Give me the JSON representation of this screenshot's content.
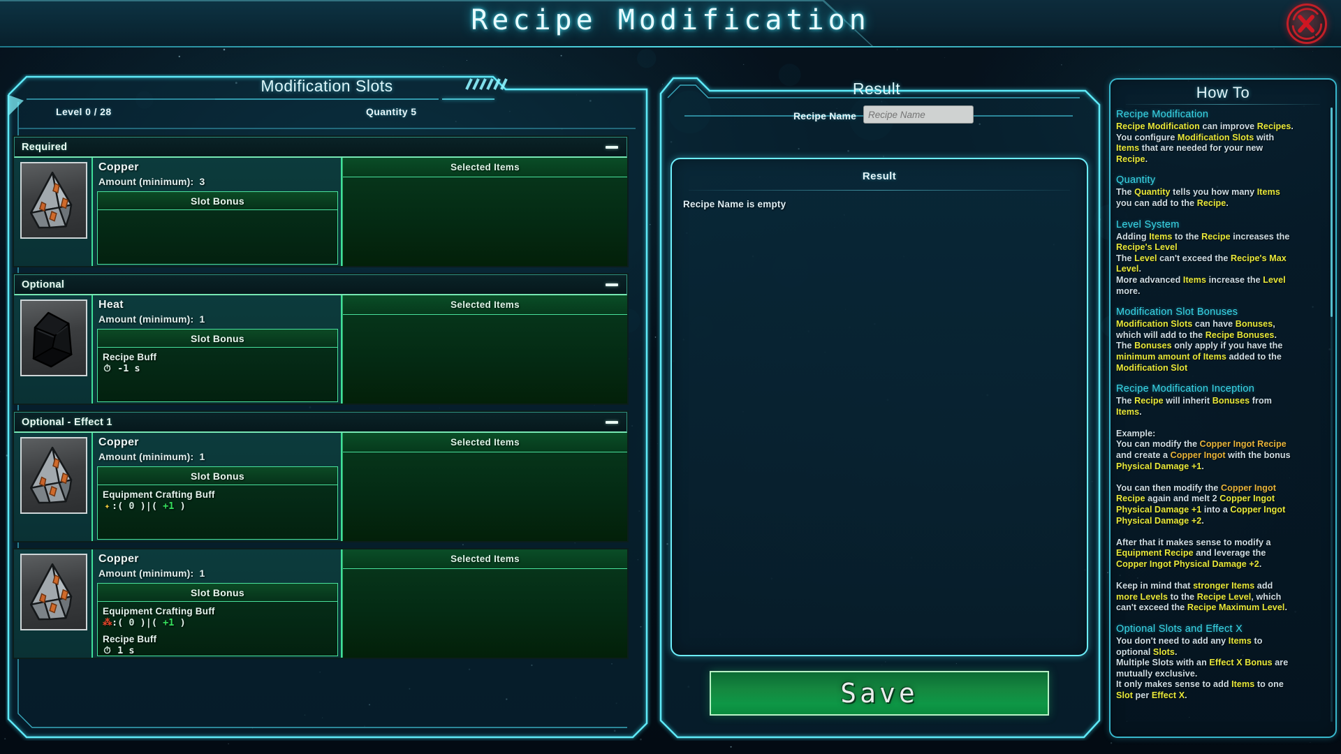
{
  "window": {
    "title": "Recipe Modification",
    "close_label": "X"
  },
  "left_panel": {
    "header": "Modification Slots",
    "level_text": "Level 0 / 28",
    "quantity_text": "Quantity 5",
    "selected_items_label": "Selected Items",
    "slot_bonus_label": "Slot Bonus",
    "groups": [
      {
        "title": "Required",
        "item_name": "Copper",
        "item_icon": "copper-ore-icon",
        "amount_label": "Amount (minimum):",
        "amount_value": "3",
        "bonuses": []
      },
      {
        "title": "Optional",
        "item_name": "Heat",
        "item_icon": "coal-icon",
        "amount_label": "Amount (minimum):",
        "amount_value": "1",
        "bonuses": [
          {
            "title": "Recipe Buff",
            "icon": "clock-icon",
            "value": "-1 s"
          }
        ]
      },
      {
        "title": "Optional - Effect 1",
        "item_name": "Copper",
        "item_icon": "copper-ore-icon",
        "amount_label": "Amount (minimum):",
        "amount_value": "1",
        "bonuses": [
          {
            "title": "Equipment Crafting Buff",
            "icon": "spark-icon",
            "value": ":( 0 )|( +1 )",
            "base": "0",
            "delta": "+1"
          }
        ]
      },
      {
        "title": "",
        "item_name": "Copper",
        "item_icon": "copper-ore-icon",
        "amount_label": "Amount (minimum):",
        "amount_value": "1",
        "bonuses": [
          {
            "title": "Equipment Crafting Buff",
            "icon": "flame-icon",
            "value": ":( 0 )|( +1 )",
            "base": "0",
            "delta": "+1"
          },
          {
            "title": "Recipe Buff",
            "icon": "clock-icon",
            "value": "1 s"
          }
        ]
      }
    ]
  },
  "center_panel": {
    "header": "Result",
    "recipe_name_label": "Recipe Name",
    "recipe_name_value": "",
    "recipe_name_placeholder": "Recipe Name",
    "result_box_header": "Result",
    "result_message": "Recipe Name is empty",
    "save_label": "Save"
  },
  "how_to": {
    "header": "How To",
    "sections": [
      {
        "heading": "Recipe Modification",
        "lines": [
          "<span class='y'>Recipe Modification</span> can improve <span class='y'>Recipes</span>.",
          "You configure <span class='y'>Modification Slots</span> with",
          "<span class='y'>Items</span> that are needed for your new",
          "<span class='y'>Recipe</span>."
        ]
      },
      {
        "heading": "Quantity",
        "lines": [
          "The <span class='y'>Quantity</span> tells you how many <span class='y'>Items</span>",
          "you can add to the <span class='y'>Recipe</span>."
        ]
      },
      {
        "heading": "Level System",
        "lines": [
          "Adding <span class='y'>Items</span> to the <span class='y'>Recipe</span> increases the",
          "<span class='y'>Recipe's Level</span>",
          "The <span class='y'>Level</span> can't exceed the <span class='y'>Recipe's Max</span>",
          "<span class='y'>Level</span>.",
          "More advanced <span class='y'>Items</span> increase the <span class='y'>Level</span>",
          "more."
        ]
      },
      {
        "heading": "Modification Slot Bonuses",
        "lines": [
          "<span class='y'>Modification Slots</span> can have <span class='y'>Bonuses</span>,",
          "which will add to the <span class='y'>Recipe Bonuses</span>.",
          "The <span class='y'>Bonuses</span> only apply if you have the",
          "<span class='y'>minimum amount of Items</span> added to the",
          "<span class='y'>Modification Slot</span>"
        ]
      },
      {
        "heading": "Recipe Modification Inception",
        "lines": [
          "The <span class='y'>Recipe</span> will inherit <span class='y'>Bonuses</span> from",
          "<span class='y'>Items</span>.",
          "",
          "Example:",
          "You can modify the <span class='o'>Copper Ingot Recipe</span>",
          "and create a <span class='o'>Copper Ingot</span> with the bonus",
          "<span class='y'>Physical Damage +1</span>.",
          "",
          "You can then modify the <span class='o'>Copper Ingot</span>",
          "<span class='y'>Recipe</span> again and melt 2 <span class='y'>Copper Ingot</span>",
          "<span class='y'>Physical Damage +1</span> into a <span class='y'>Copper Ingot</span>",
          "<span class='y'>Physical Damage +2</span>.",
          "",
          "After that it makes sense to modify a",
          "<span class='y'>Equipment Recipe</span> and leverage the",
          "<span class='y'>Copper Ingot Physical Damage +2</span>.",
          "",
          "Keep in mind that <span class='y'>stronger Items</span> add",
          "<span class='y'>more Levels</span> to the <span class='y'>Recipe Level</span>, which",
          "can't exceed the <span class='y'>Recipe Maximum Level</span>."
        ]
      },
      {
        "heading": "Optional Slots and Effect X",
        "lines": [
          "You don't need to add any <span class='y'>Items</span> to",
          "optional <span class='y'>Slots</span>.",
          "Multiple Slots with an <span class='y'>Effect X Bonus</span> are",
          "mutually exclusive.",
          "It only makes sense to add <span class='y'>Items</span> to one",
          "<span class='y'>Slot</span> per <span class='y'>Effect X</span>."
        ]
      }
    ]
  },
  "colors": {
    "accent_cyan": "#5fe9f7",
    "heading_cyan": "#39d8e8",
    "highlight_yellow": "#e8e83a",
    "highlight_orange": "#e8b43a",
    "slot_green": "#49e39d",
    "save_green": "#0e9746",
    "close_red": "#c21f28"
  }
}
